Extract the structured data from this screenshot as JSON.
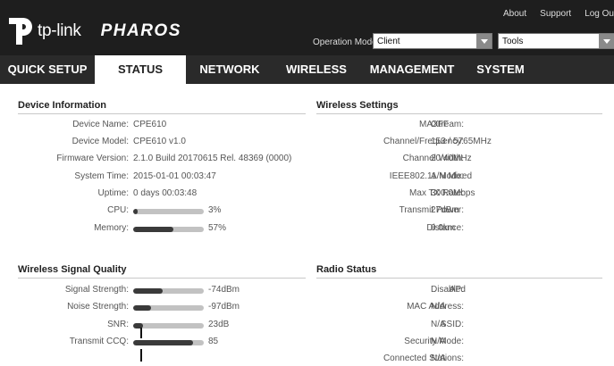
{
  "header": {
    "brand": "tp-link",
    "product": "PHAROS",
    "links": [
      "About",
      "Support",
      "Log Ou"
    ],
    "operation_mode_label": "Operation Mode:",
    "operation_mode_value": "Client",
    "tools_value": "Tools"
  },
  "nav": {
    "tabs": [
      "QUICK SETUP",
      "STATUS",
      "NETWORK",
      "WIRELESS",
      "MANAGEMENT",
      "SYSTEM"
    ],
    "active": "STATUS"
  },
  "device_info": {
    "title": "Device Information",
    "rows": [
      {
        "label": "Device Name:",
        "value": "CPE610"
      },
      {
        "label": "Device Model:",
        "value": "CPE610 v1.0"
      },
      {
        "label": "Firmware Version:",
        "value": "2.1.0 Build 20170615 Rel. 48369 (0000)"
      },
      {
        "label": "System Time:",
        "value": "2015-01-01 00:03:47"
      },
      {
        "label": "Uptime:",
        "value": "0 days 00:03:48"
      }
    ],
    "cpu": {
      "label": "CPU:",
      "value": "3%",
      "level": 0.03
    },
    "memory": {
      "label": "Memory:",
      "value": "57%",
      "level": 0.57
    }
  },
  "wireless_settings": {
    "title": "Wireless Settings",
    "rows": [
      {
        "label": "MAXtream:",
        "value": "OFF"
      },
      {
        "label": "Channel/Frequency:",
        "value": "153 / 5765MHz"
      },
      {
        "label": "Channel Width:",
        "value": "20/40MHz"
      },
      {
        "label": "IEEE802.11 Mode:",
        "value": "A/N Mixed"
      },
      {
        "label": "Max TX Rate:",
        "value": "300.0Mbps"
      },
      {
        "label": "Transmit Power:",
        "value": "27dBm"
      },
      {
        "label": "Distance:",
        "value": "0.0km"
      }
    ]
  },
  "signal_quality": {
    "title": "Wireless Signal Quality",
    "rows": [
      {
        "label": "Signal Strength:",
        "value": "-74dBm",
        "level": 0.42
      },
      {
        "label": "Noise Strength:",
        "value": "-97dBm",
        "level": 0.25
      },
      {
        "label": "SNR:",
        "value": "23dB",
        "level": 0.14
      },
      {
        "label": "Transmit CCQ:",
        "value": "85",
        "level": 0.85
      }
    ]
  },
  "radio_status": {
    "title": "Radio Status",
    "rows": [
      {
        "label": "AP:",
        "value": "Disabled"
      },
      {
        "label": "MAC Address:",
        "value": "N/A"
      },
      {
        "label": "SSID:",
        "value": "N/A"
      },
      {
        "label": "Security Mode:",
        "value": "N/A"
      },
      {
        "label": "Connected Stations:",
        "value": "N/A"
      }
    ]
  }
}
